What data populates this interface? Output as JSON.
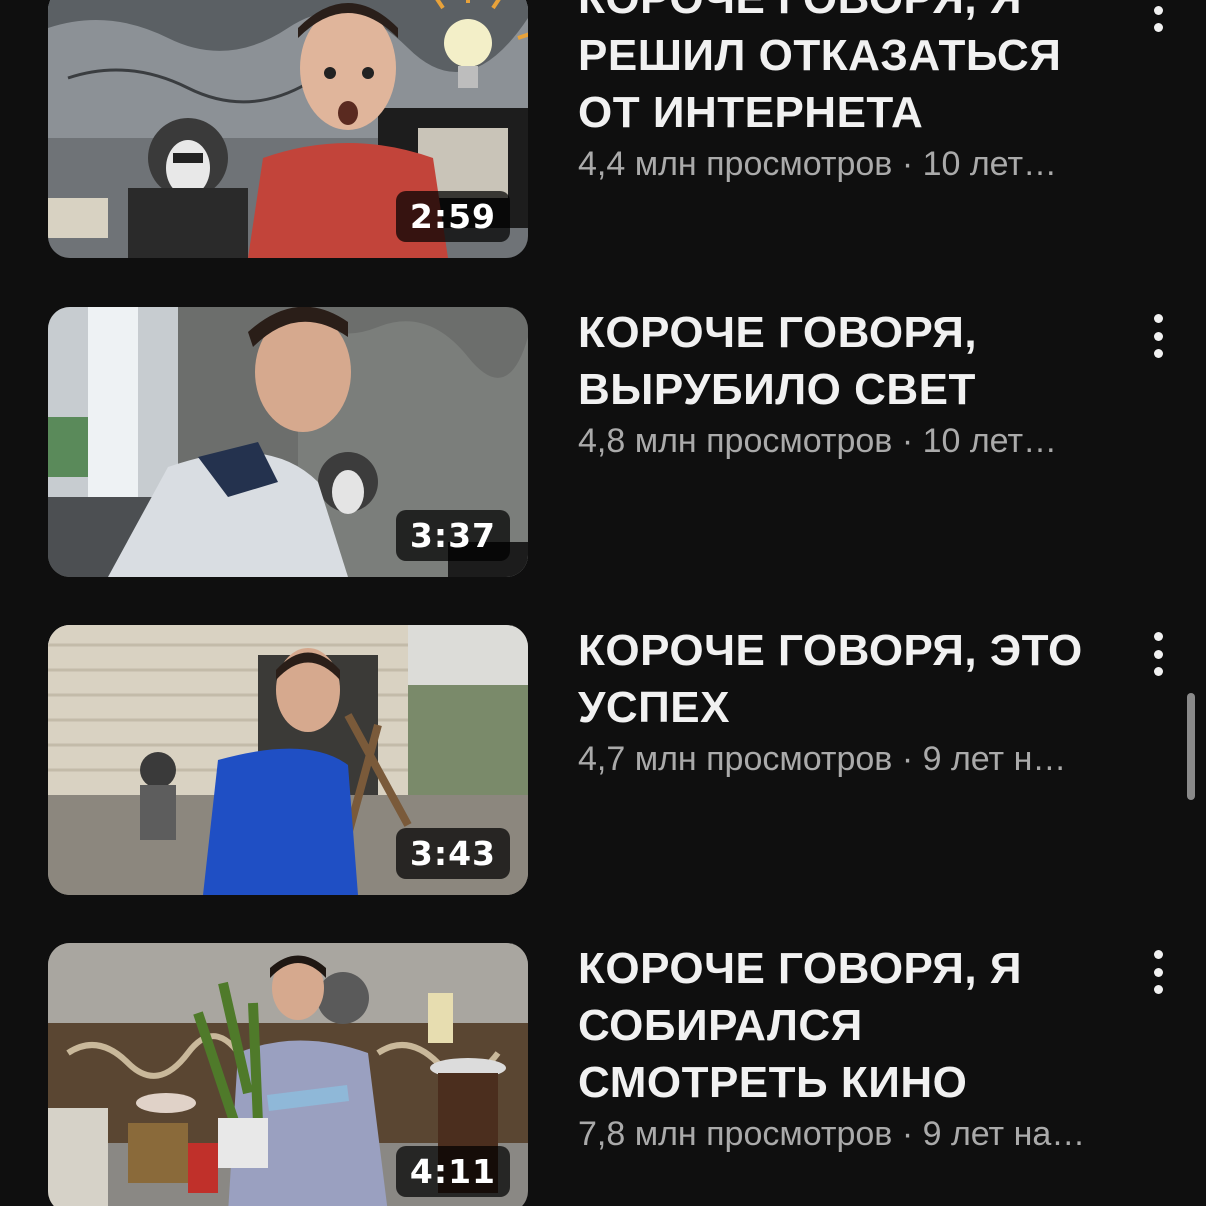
{
  "videos": [
    {
      "title_lines": [
        "КОРОЧЕ ГОВОРЯ, Я",
        "РЕШИЛ ОТКАЗАТЬСЯ",
        "ОТ ИНТЕРНЕТА"
      ],
      "meta": "4,4 млн просмотров · 10 лет…",
      "duration": "2:59",
      "menu_icon": "more-vert-icon"
    },
    {
      "title_lines": [
        "КОРОЧЕ ГОВОРЯ,",
        "ВЫРУБИЛО СВЕТ"
      ],
      "meta": "4,8 млн просмотров · 10 лет…",
      "duration": "3:37",
      "menu_icon": "more-vert-icon"
    },
    {
      "title_lines": [
        "КОРОЧЕ ГОВОРЯ, ЭТО",
        "УСПЕХ"
      ],
      "meta": "4,7 млн просмотров · 9 лет н…",
      "duration": "3:43",
      "menu_icon": "more-vert-icon"
    },
    {
      "title_lines": [
        "КОРОЧЕ ГОВОРЯ, Я",
        "СОБИРАЛСЯ",
        "СМОТРЕТЬ КИНО"
      ],
      "meta": "7,8 млн просмотров · 9 лет на…",
      "duration": "4:11",
      "menu_icon": "more-vert-icon"
    }
  ],
  "colors": {
    "background": "#0f0f0f",
    "title": "#f1f1f1",
    "meta": "#aaaaaa"
  }
}
